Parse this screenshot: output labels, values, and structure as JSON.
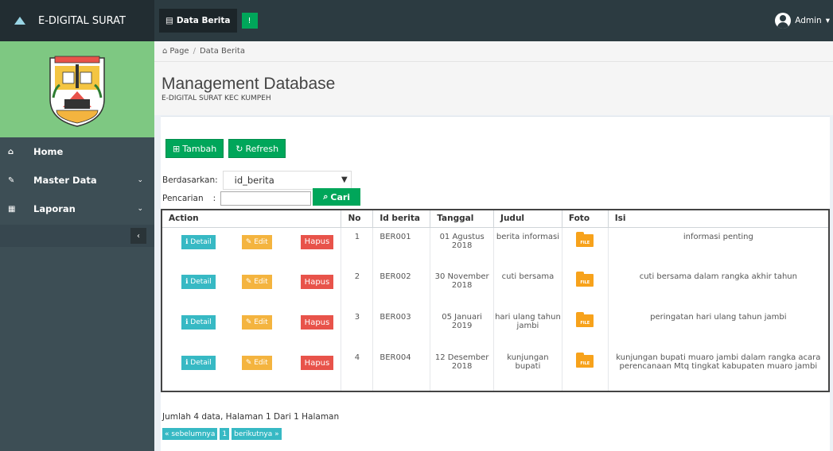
{
  "app": {
    "title": "E-DIGITAL SURAT"
  },
  "topnav": {
    "data_berita": "Data Berita",
    "user": "Admin"
  },
  "sidebar": {
    "items": [
      {
        "label": "Home",
        "icon": "home-icon"
      },
      {
        "label": "Master Data",
        "icon": "edit-icon"
      },
      {
        "label": "Laporan",
        "icon": "calendar-icon"
      }
    ]
  },
  "breadcrumb": {
    "root": "Page",
    "current": "Data Berita"
  },
  "page": {
    "title": "Management Database",
    "subtitle": "E-DIGITAL SURAT KEC KUMPEH"
  },
  "toolbar": {
    "tambah": "Tambah",
    "refresh": "Refresh"
  },
  "filter": {
    "by_label": "Berdasarkan:",
    "by_value": "id_berita",
    "search_label": "Pencarian",
    "search_button": "Cari"
  },
  "table": {
    "headers": [
      "Action",
      "No",
      "Id berita",
      "Tanggal",
      "Judul",
      "Foto",
      "Isi"
    ],
    "row_buttons": {
      "detail": "Detail",
      "edit": "Edit",
      "hapus": "Hapus"
    },
    "file_badge": "FILE",
    "rows": [
      {
        "no": "1",
        "id": "BER001",
        "tanggal": "01 Agustus 2018",
        "judul": "berita informasi",
        "isi": "informasi penting"
      },
      {
        "no": "2",
        "id": "BER002",
        "tanggal": "30 November 2018",
        "judul": "cuti bersama",
        "isi": "cuti bersama dalam rangka akhir tahun"
      },
      {
        "no": "3",
        "id": "BER003",
        "tanggal": "05 Januari 2019",
        "judul": "hari ulang tahun jambi",
        "isi": "peringatan hari ulang tahun jambi"
      },
      {
        "no": "4",
        "id": "BER004",
        "tanggal": "12 Desember 2018",
        "judul": "kunjungan bupati",
        "isi": "kunjungan bupati muaro jambi dalam rangka acara perencanaan Mtq tingkat kabupaten muaro jambi"
      }
    ]
  },
  "footer": {
    "info": "Jumlah 4 data, Halaman 1 Dari 1 Halaman",
    "prev": "« sebelumnya",
    "page": "1",
    "next": "berikutnya »"
  },
  "colors": {
    "green": "#00a65a",
    "sidebar": "#3d4e55",
    "topbar": "#2c3b41",
    "detail": "#37b9c4",
    "edit": "#f4b43f",
    "hapus": "#e8534a"
  }
}
